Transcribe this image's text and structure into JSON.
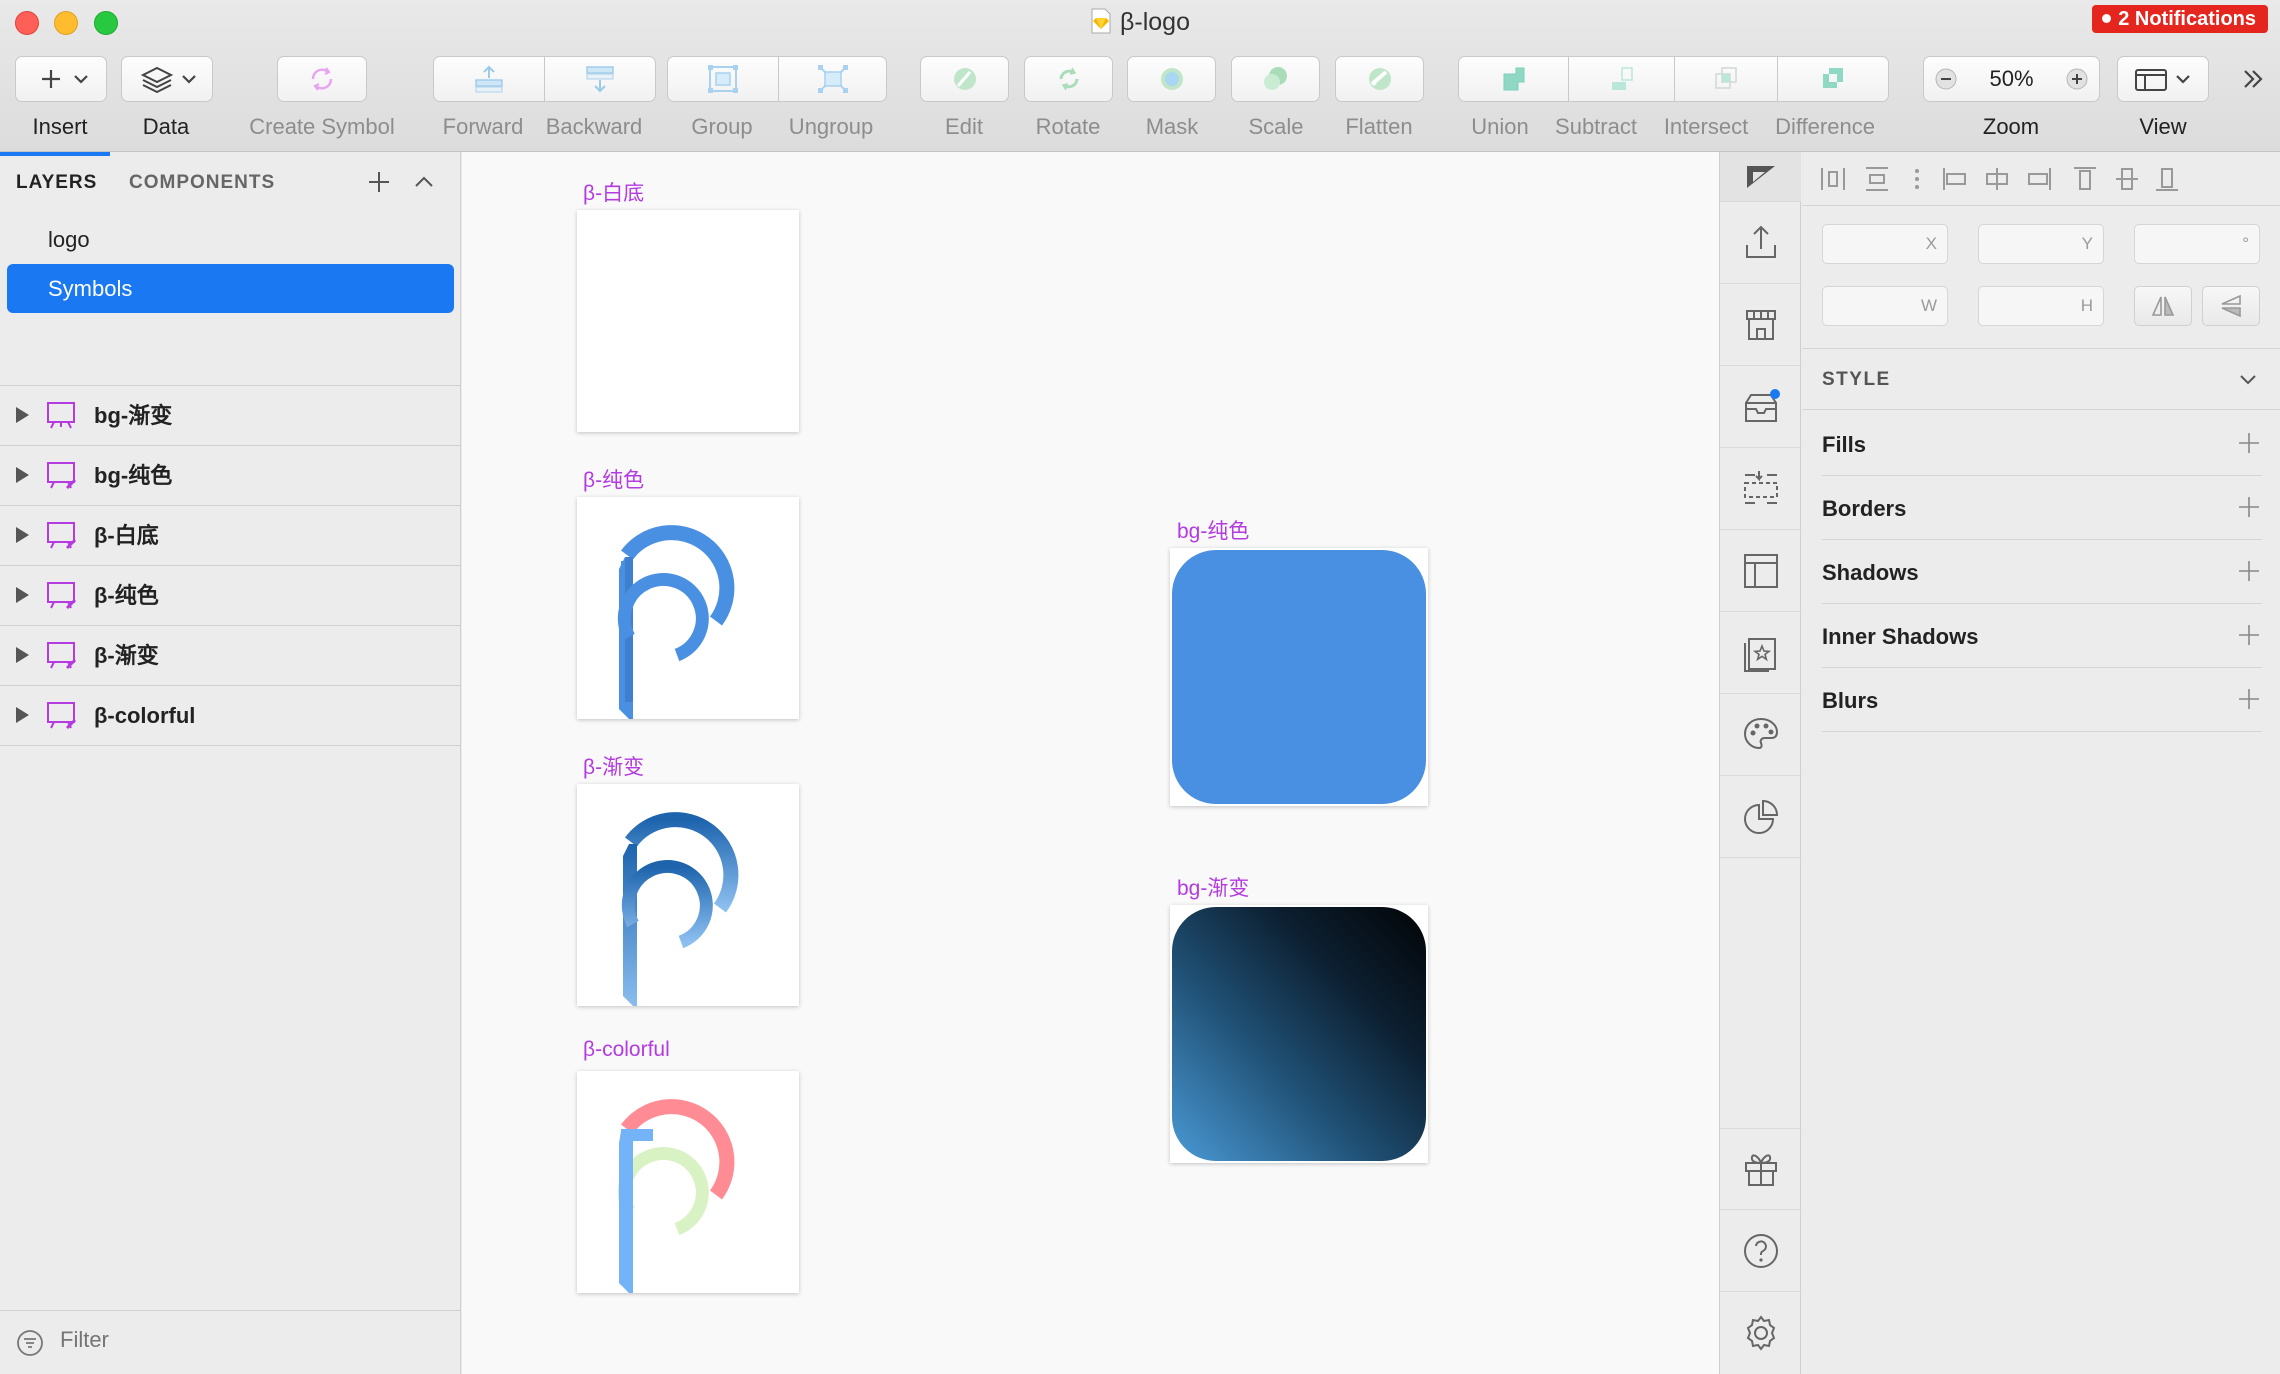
{
  "window": {
    "title": "β-logo",
    "notifications": "2 Notifications"
  },
  "toolbar": {
    "insert": "Insert",
    "data": "Data",
    "create_symbol": "Create Symbol",
    "forward": "Forward",
    "backward": "Backward",
    "group": "Group",
    "ungroup": "Ungroup",
    "edit": "Edit",
    "rotate": "Rotate",
    "mask": "Mask",
    "scale": "Scale",
    "flatten": "Flatten",
    "union": "Union",
    "subtract": "Subtract",
    "intersect": "Intersect",
    "difference": "Difference",
    "zoom_value": "50%",
    "zoom": "Zoom",
    "view": "View"
  },
  "layers_panel": {
    "tab_layers": "LAYERS",
    "tab_components": "COMPONENTS",
    "pages": [
      {
        "label": "logo"
      },
      {
        "label": "Symbols"
      }
    ],
    "layers": [
      {
        "name": "bg-渐变"
      },
      {
        "name": "bg-纯色"
      },
      {
        "name": "β-白底"
      },
      {
        "name": "β-纯色"
      },
      {
        "name": "β-渐变"
      },
      {
        "name": "β-colorful"
      }
    ],
    "filter_placeholder": "Filter"
  },
  "canvas": {
    "artboards": [
      {
        "label": "β-白底"
      },
      {
        "label": "β-纯色"
      },
      {
        "label": "β-渐变"
      },
      {
        "label": "β-colorful"
      },
      {
        "label": "bg-纯色"
      },
      {
        "label": "bg-渐变"
      }
    ]
  },
  "inspector": {
    "x_label": "X",
    "y_label": "Y",
    "rotation_label": "°",
    "w_label": "W",
    "h_label": "H",
    "style_title": "STYLE",
    "sections": [
      {
        "label": "Fills"
      },
      {
        "label": "Borders"
      },
      {
        "label": "Shadows"
      },
      {
        "label": "Inner Shadows"
      },
      {
        "label": "Blurs"
      }
    ]
  },
  "colors": {
    "accent": "#1a79f2",
    "artboard_label": "#b33be0",
    "solid_blue": "#4a90e2",
    "gradient_dark": "#020406",
    "gradient_light": "#4a9ad6",
    "colorful_pink": "#ff8c94",
    "colorful_green": "#d8f2c4",
    "colorful_blue": "#74b3f7"
  }
}
